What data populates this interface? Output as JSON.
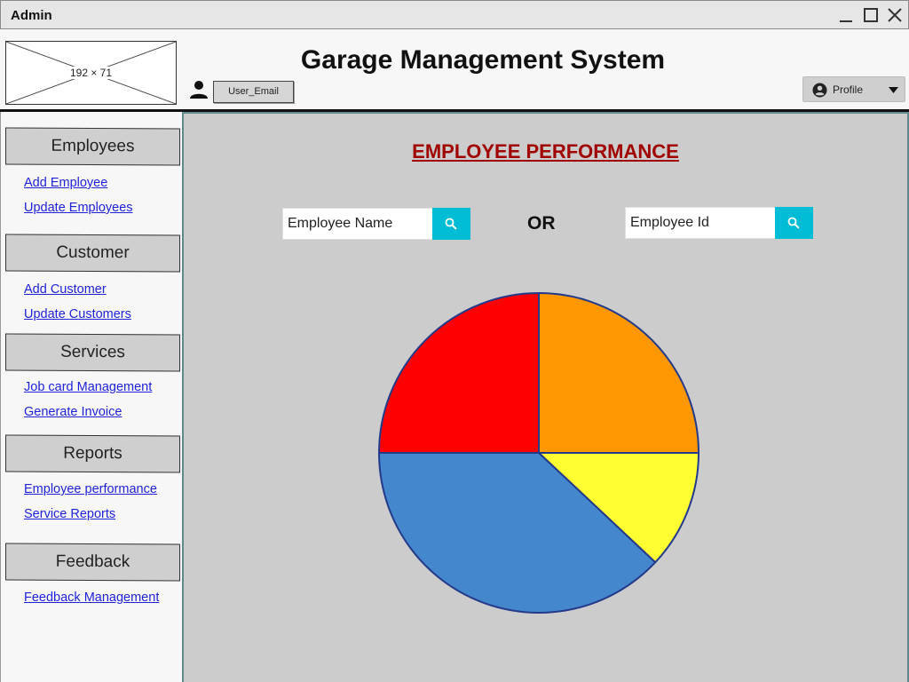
{
  "window": {
    "title": "Admin"
  },
  "header": {
    "logo_placeholder": "192 × 71",
    "user_email": "User_Email",
    "app_title": "Garage Management System",
    "profile_label": "Profile"
  },
  "sidebar": {
    "sections": [
      {
        "label": "Employees",
        "links": [
          "Add Employee",
          "Update Employees"
        ]
      },
      {
        "label": "Customer",
        "links": [
          "Add Customer",
          "Update Customers"
        ]
      },
      {
        "label": "Services",
        "links": [
          "Job card Management",
          "Generate Invoice"
        ]
      },
      {
        "label": "Reports",
        "links": [
          "Employee performance",
          "Service Reports"
        ]
      },
      {
        "label": "Feedback",
        "links": [
          "Feedback Management"
        ]
      }
    ]
  },
  "main": {
    "title": "EMPLOYEE PERFORMANCE",
    "search_name_value": "Employee Name",
    "or_text": "OR",
    "search_id_value": "Employee Id"
  },
  "chart_data": {
    "type": "pie",
    "values": [
      25,
      12,
      38,
      25
    ],
    "colors": [
      "#ff9800",
      "#ffff33",
      "#4487cc",
      "#ff0000"
    ],
    "stroke": "#233a8a"
  },
  "colors": {
    "link": "#1f23d8",
    "title_red": "#a00000",
    "search_button": "#00bcd4",
    "content_bg": "#cccccc"
  }
}
